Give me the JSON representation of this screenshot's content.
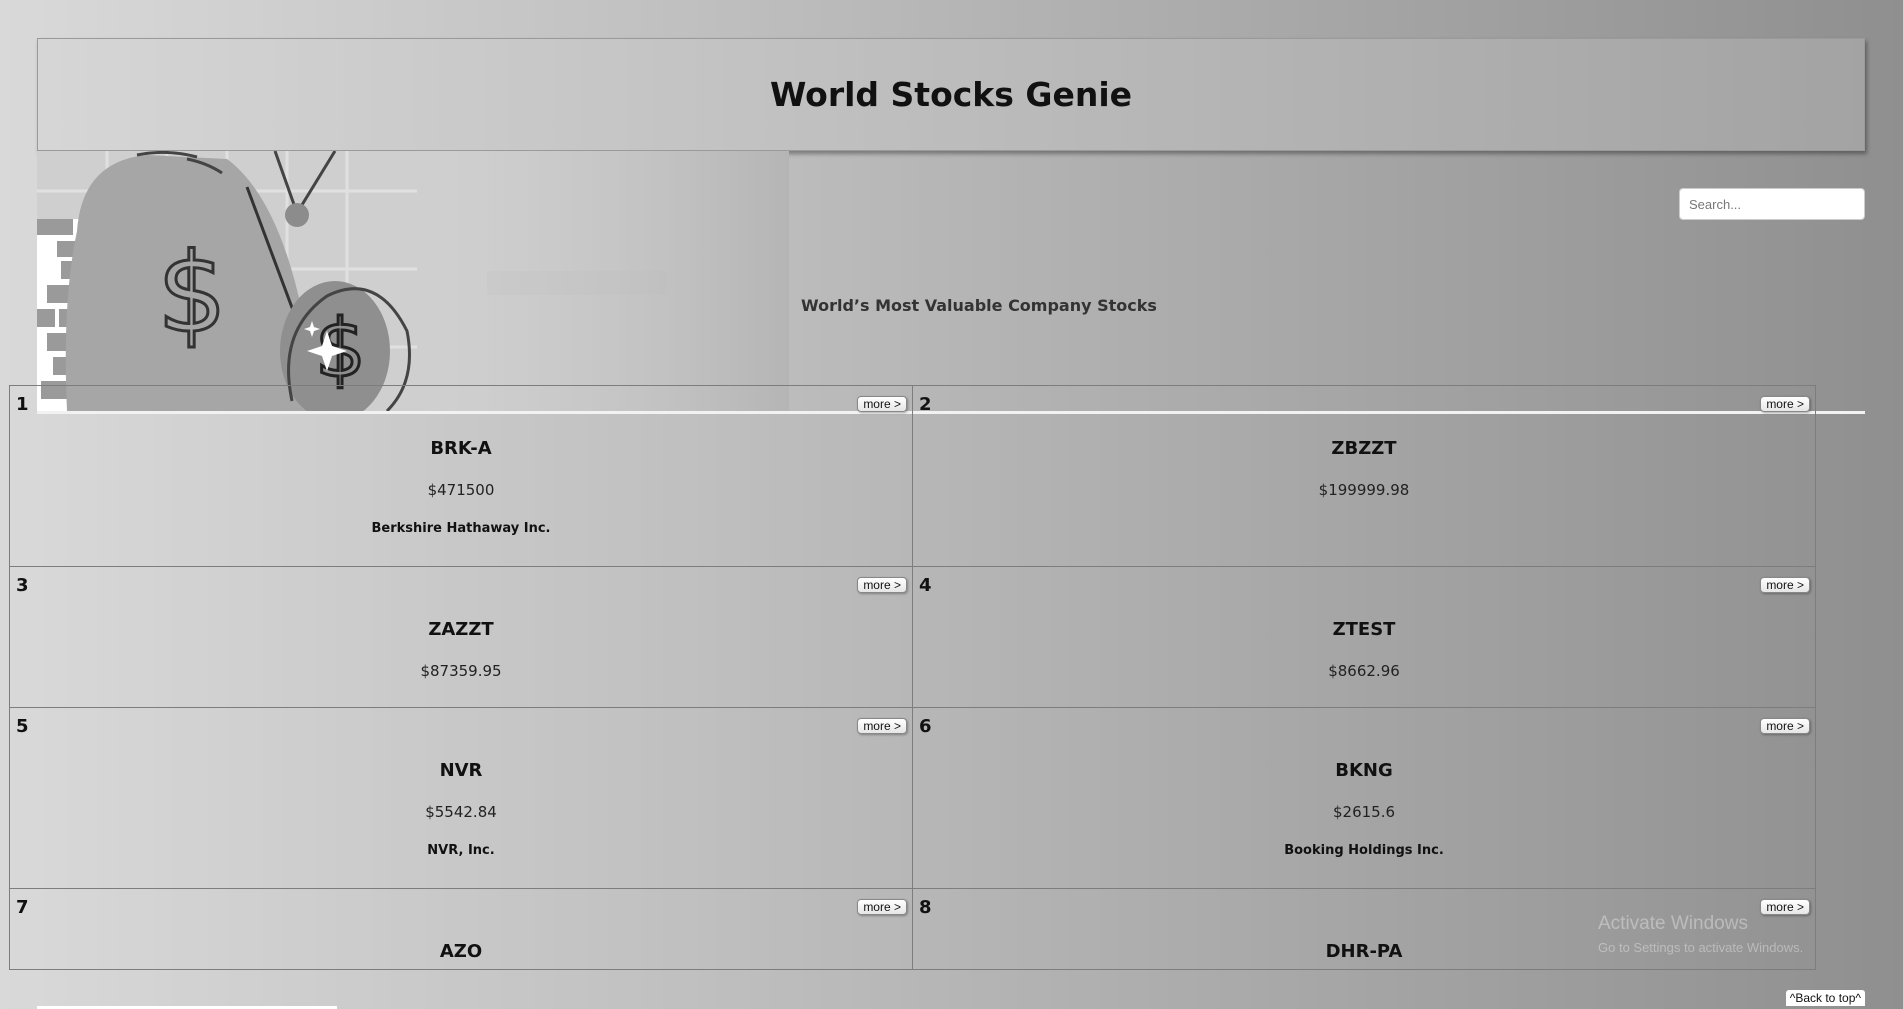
{
  "header": {
    "title": "World Stocks Genie"
  },
  "hero": {
    "tagline": "World’s Most Valuable Company Stocks"
  },
  "search": {
    "placeholder": "Search..."
  },
  "stocks": [
    {
      "rank": "1",
      "ticker": "BRK-A",
      "price": "$471500",
      "company": "Berkshire Hathaway Inc.",
      "more": "more >"
    },
    {
      "rank": "2",
      "ticker": "ZBZZT",
      "price": "$199999.98",
      "company": "",
      "more": "more >"
    },
    {
      "rank": "3",
      "ticker": "ZAZZT",
      "price": "$87359.95",
      "company": "",
      "more": "more >"
    },
    {
      "rank": "4",
      "ticker": "ZTEST",
      "price": "$8662.96",
      "company": "",
      "more": "more >"
    },
    {
      "rank": "5",
      "ticker": "NVR",
      "price": "$5542.84",
      "company": "NVR, Inc.",
      "more": "more >"
    },
    {
      "rank": "6",
      "ticker": "BKNG",
      "price": "$2615.6",
      "company": "Booking Holdings Inc.",
      "more": "more >"
    },
    {
      "rank": "7",
      "ticker": "AZO",
      "price": "",
      "company": "",
      "more": "more >"
    },
    {
      "rank": "8",
      "ticker": "DHR-PA",
      "price": "",
      "company": "",
      "more": "more >"
    }
  ],
  "footer": {
    "back_to_top": "^Back to top^"
  },
  "os_watermark": {
    "line1": "Activate Windows",
    "line2": "Go to Settings to activate Windows."
  },
  "colors": {
    "background_left": "#d9d9d9",
    "background_right": "#8f8f8f",
    "card_border": "#7d7d7d",
    "hero_divider": "#f2f2f2"
  },
  "icons": [
    "money-bag-icon",
    "coin-icon",
    "sparkle-icon"
  ]
}
